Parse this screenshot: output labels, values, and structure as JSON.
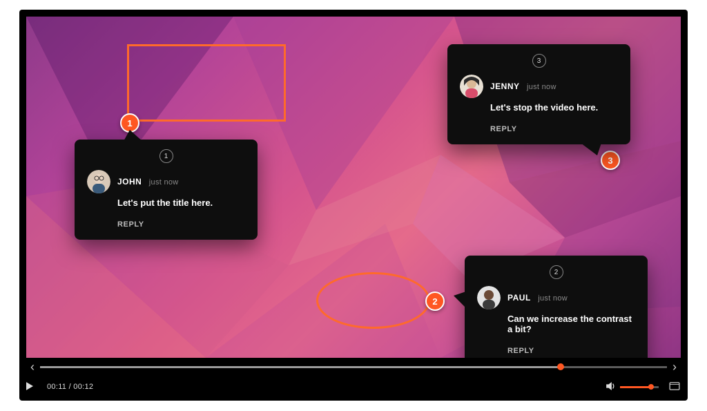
{
  "colors": {
    "accent": "#ff5722",
    "annotation": "#ff6a2a",
    "card_bg": "#0e0e0e"
  },
  "markers": {
    "m1": "1",
    "m2": "2",
    "m3": "3"
  },
  "comments": {
    "c1": {
      "seq": "1",
      "name": "JOHN",
      "time": "just now",
      "msg": "Let's put the title here.",
      "reply": "REPLY"
    },
    "c2": {
      "seq": "2",
      "name": "PAUL",
      "time": "just now",
      "msg": "Can we increase the contrast a bit?",
      "reply": "REPLY"
    },
    "c3": {
      "seq": "3",
      "name": "JENNY",
      "time": "just now",
      "msg": "Let's stop the video here.",
      "reply": "REPLY"
    }
  },
  "playback": {
    "current": "00:11",
    "duration": "00:12",
    "sep": " / "
  },
  "icons": {
    "chev_left": "‹",
    "chev_right": "›"
  }
}
